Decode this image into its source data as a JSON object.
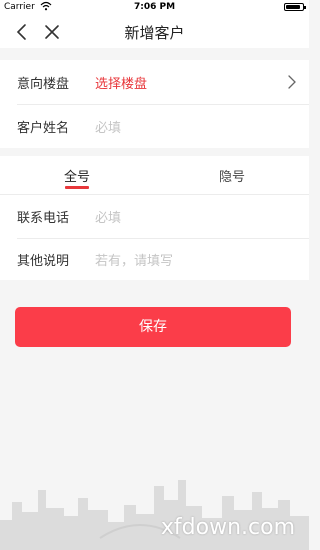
{
  "status_bar": {
    "carrier": "Carrier",
    "time": "7:06 PM",
    "battery_level": 0.9
  },
  "nav": {
    "title": "新增客户",
    "back_icon": "chevron-left-icon",
    "close_icon": "close-icon"
  },
  "form1": {
    "property_label": "意向楼盘",
    "property_value": "选择楼盘",
    "name_label": "客户姓名",
    "name_placeholder": "必填"
  },
  "tabs": [
    {
      "label": "全号",
      "active": true
    },
    {
      "label": "隐号",
      "active": false
    }
  ],
  "form2": {
    "phone_label": "联系电话",
    "phone_placeholder": "必填",
    "note_label": "其他说明",
    "note_placeholder": "若有，请填写"
  },
  "save_label": "保存",
  "watermark": "xfdown.com",
  "colors": {
    "accent": "#e8373b",
    "button": "#fb3d49",
    "placeholder": "#c5c5c5",
    "background": "#f5f5f5"
  }
}
